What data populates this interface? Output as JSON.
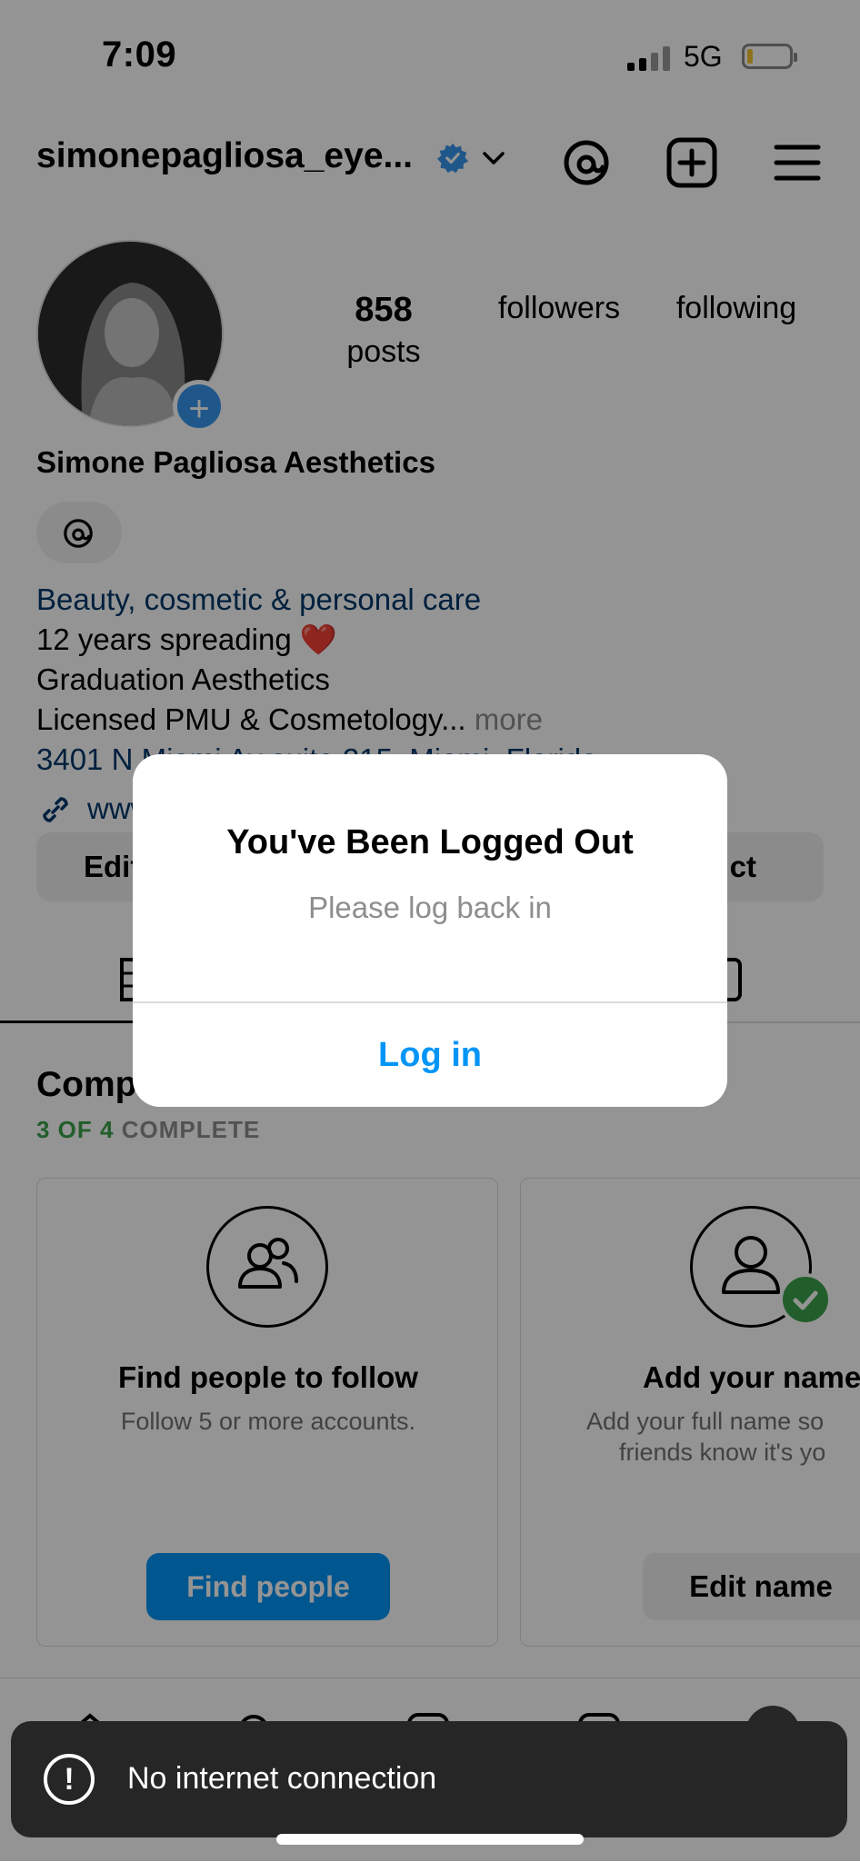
{
  "status_bar": {
    "time": "7:09",
    "network": "5G"
  },
  "header": {
    "username": "simonepagliosa_eye..."
  },
  "profile": {
    "stats": [
      {
        "value": "858",
        "label": "posts"
      },
      {
        "value": "",
        "label": "followers"
      },
      {
        "value": "",
        "label": "following"
      }
    ],
    "full_name": "Simone Pagliosa Aesthetics",
    "category": "Beauty, cosmetic & personal care",
    "bio_lines": [
      "12 years spreading ❤️",
      "Graduation Aesthetics",
      "Licensed PMU & Cosmetology..."
    ],
    "more_label": "more",
    "address": "3401 N Miami Av suite 215, Miami, Florida",
    "link": "www",
    "edit_label": "Edit",
    "contact_label": "ct"
  },
  "completion": {
    "title": "Comp",
    "count": "3 OF 4",
    "status": "COMPLETE",
    "cards": [
      {
        "title": "Find people to follow",
        "desc": "Follow 5 or more accounts.",
        "button": "Find people"
      },
      {
        "title": "Add your name",
        "desc_line1": "Add your full name so",
        "desc_line2": "friends know it's yo",
        "button": "Edit name"
      }
    ]
  },
  "modal": {
    "title": "You've Been Logged Out",
    "message": "Please log back in",
    "button": "Log in"
  },
  "toast": {
    "icon": "!",
    "message": "No internet connection"
  },
  "colors": {
    "accent": "#0095f6",
    "success": "#3ca34a",
    "toast_bg": "#262626"
  }
}
